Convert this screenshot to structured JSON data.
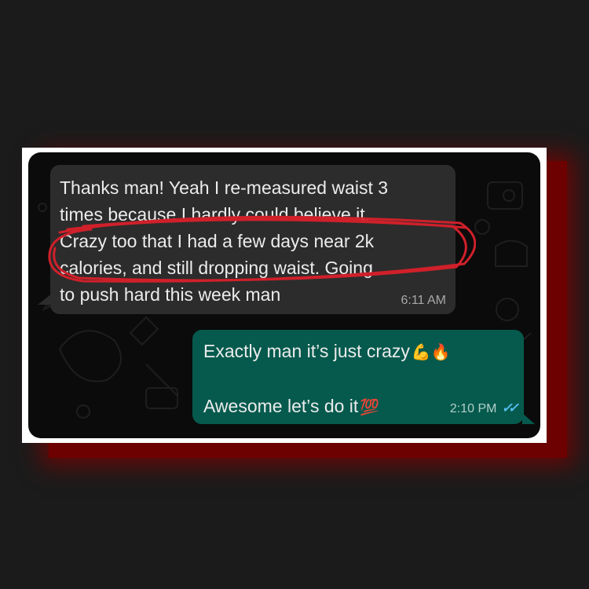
{
  "incoming_message": {
    "lines": [
      "Thanks man! Yeah I re-measured waist 3",
      "times because I hardly could believe it.",
      "Crazy too that I had a few days near 2k",
      "calories, and still dropping waist. Going",
      "to push hard this week man"
    ],
    "time": "6:11 AM"
  },
  "outgoing_message": {
    "line1": "Exactly man it’s just crazy",
    "line1_emojis": "💪🔥",
    "line2": "Awesome let’s do it",
    "line2_emoji": "💯",
    "time": "2:10 PM",
    "read_ticks": "✓✓"
  },
  "colors": {
    "page_background": "#1b1b1b",
    "red_shadow": "#6d0000",
    "chat_background": "#0b0b0b",
    "incoming_bubble": "#2c2c2c",
    "outgoing_bubble": "#055a4d",
    "highlight_scribble": "#d0202a",
    "read_ticks": "#53bdeb"
  }
}
